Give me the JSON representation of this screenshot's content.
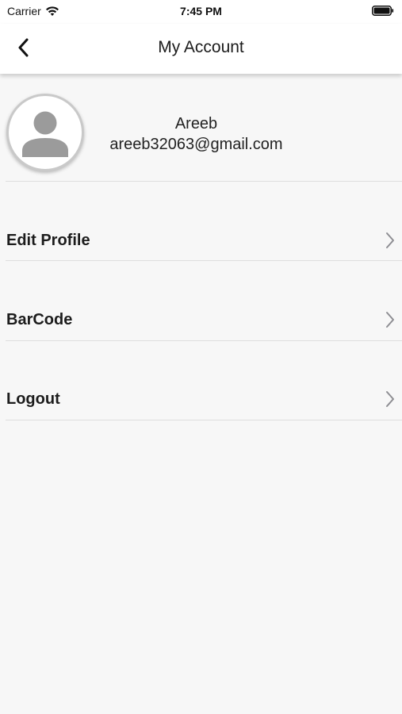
{
  "status_bar": {
    "carrier": "Carrier",
    "time": "7:45 PM",
    "wifi_icon": "wifi-icon",
    "battery_icon": "battery-icon"
  },
  "nav": {
    "title": "My Account",
    "back_icon": "chevron-left-icon"
  },
  "profile": {
    "name": "Areeb",
    "email": "areeb32063@gmail.com",
    "avatar_icon": "person-icon"
  },
  "menu": {
    "items": [
      {
        "label": "Edit Profile",
        "icon": "chevron-right-icon"
      },
      {
        "label": "BarCode",
        "icon": "chevron-right-icon"
      },
      {
        "label": "Logout",
        "icon": "chevron-right-icon"
      }
    ]
  },
  "colors": {
    "background": "#f7f7f7",
    "header": "#ffffff",
    "divider": "#dedede",
    "avatar_glyph": "#9b9b9b",
    "chevron": "#8e8e93"
  }
}
